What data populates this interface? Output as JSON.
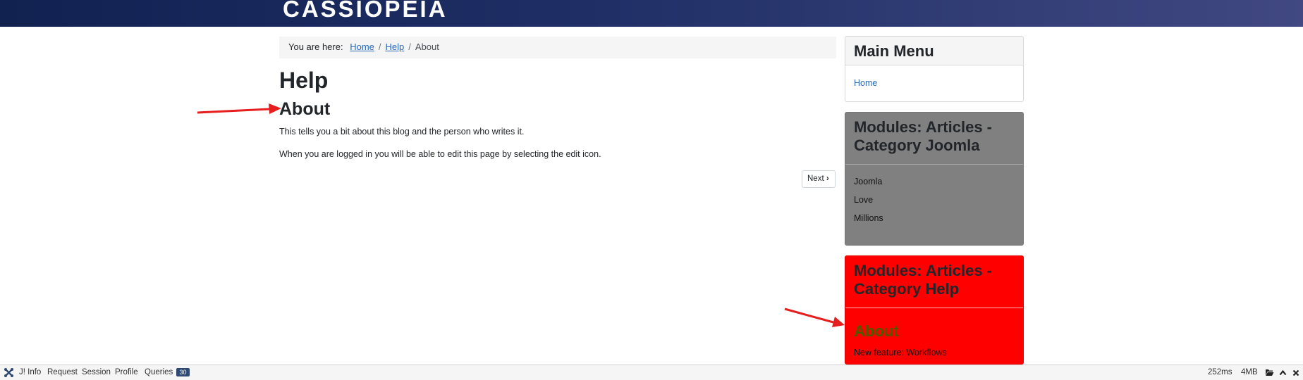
{
  "header": {
    "brand": "CASSIOPEIA"
  },
  "breadcrumb": {
    "lead": "You are here:",
    "items": [
      "Home",
      "Help",
      "About"
    ]
  },
  "page": {
    "heading": "Help",
    "article_title": "About",
    "paragraphs": [
      "This tells you a bit about this blog and the person who writes it.",
      "When you are logged in you will be able to edit this page by selecting the edit icon."
    ],
    "next_label": "Next"
  },
  "sidebar": {
    "main_menu": {
      "title": "Main Menu",
      "items": [
        "Home"
      ]
    },
    "joomla_module": {
      "title": "Modules: Articles - Category Joomla",
      "items": [
        "Joomla",
        "Love",
        "Millions"
      ]
    },
    "help_module": {
      "title": "Modules: Articles - Category Help",
      "article_title": "About",
      "text": "New feature: Workflows"
    }
  },
  "debugbar": {
    "items": [
      "J! Info",
      "Request",
      "Session",
      "Profile",
      "Queries"
    ],
    "queries_count": "30",
    "time": "252ms",
    "memory": "4MB"
  },
  "colors": {
    "header_start": "#112150",
    "header_end": "#414882",
    "joomla_module_bg": "#808080",
    "help_module_bg": "#ff0000",
    "annotation_arrow": "#e61e1e",
    "link": "#2a69b8"
  },
  "icons": [
    "joomla-logo-icon",
    "chevron-right-icon",
    "arrow-annotation-icon",
    "folder-open-icon",
    "chevron-up-icon",
    "close-icon"
  ]
}
